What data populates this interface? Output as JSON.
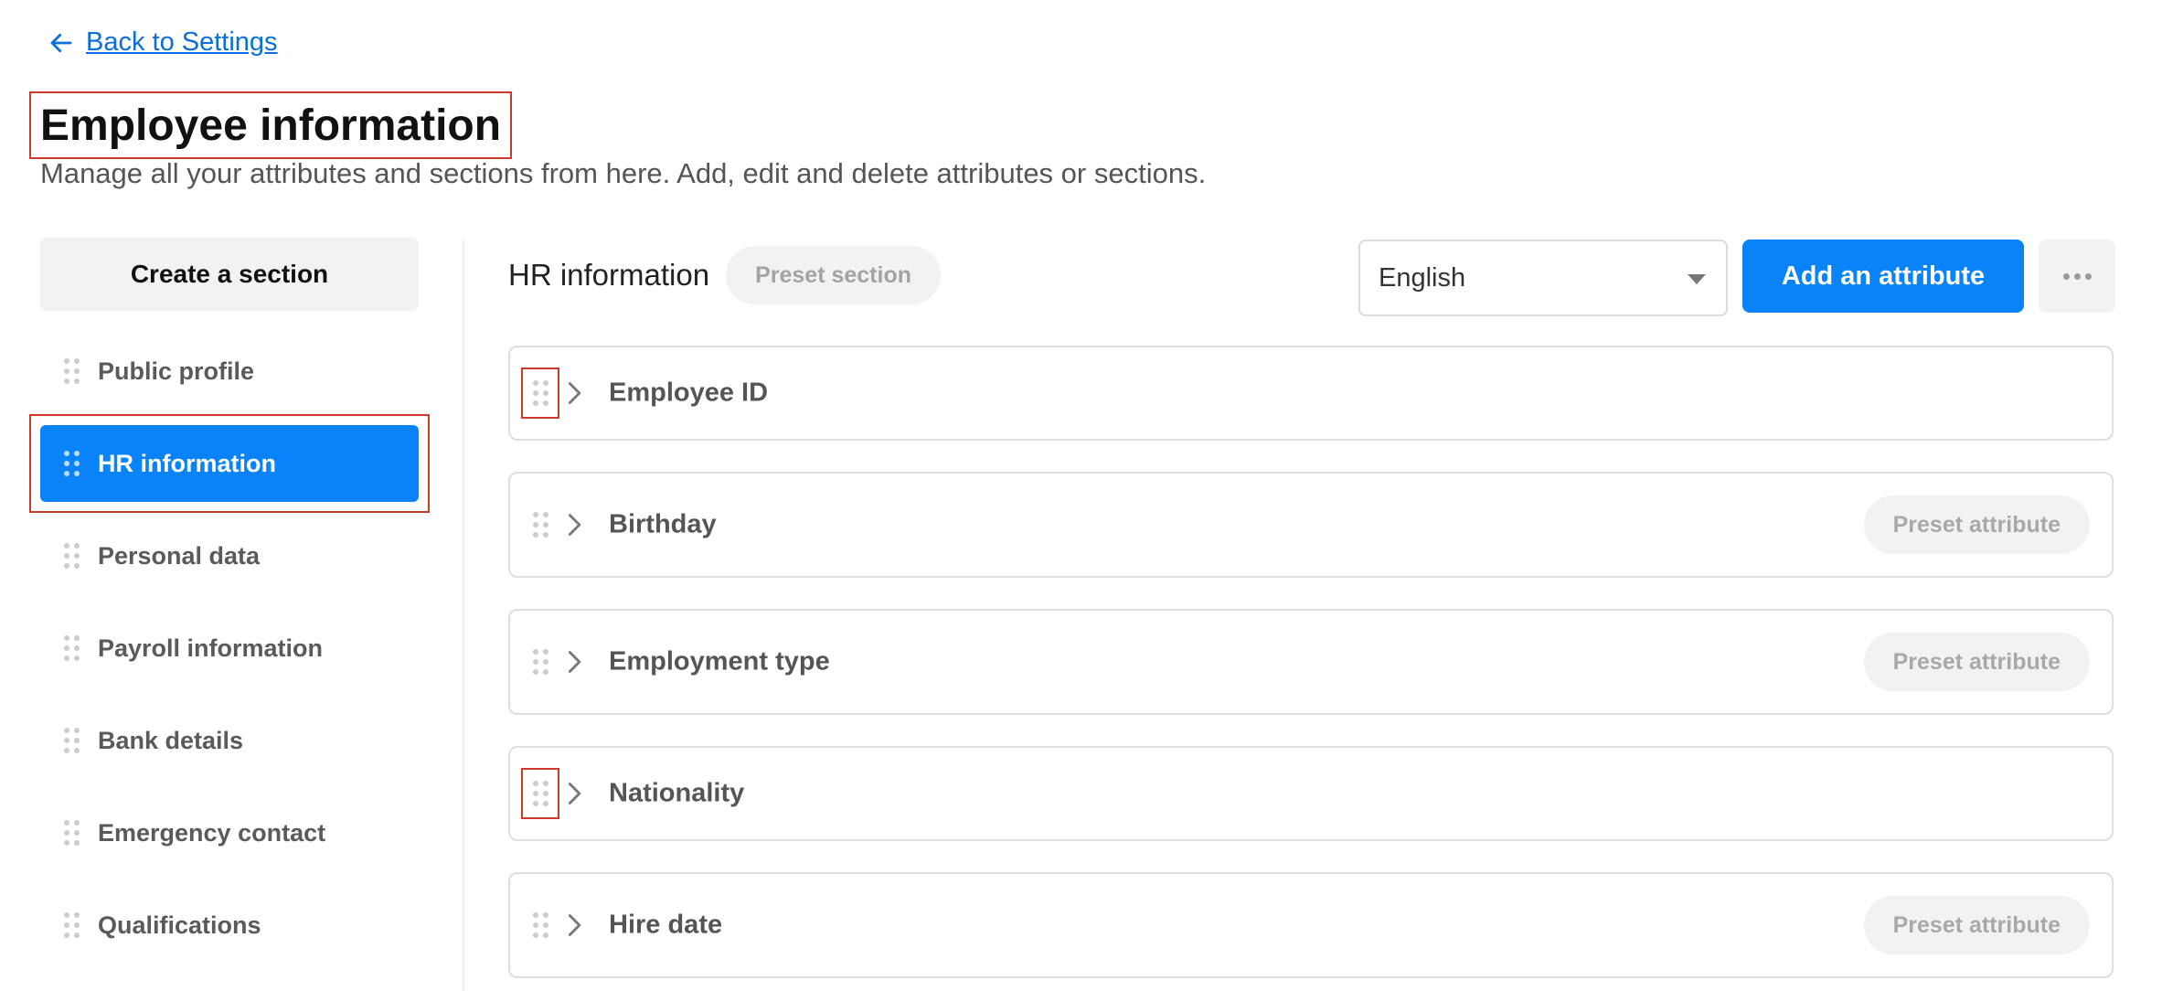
{
  "back_link": {
    "label": "Back to Settings"
  },
  "header": {
    "title": "Employee information",
    "subtitle": "Manage all your attributes and sections from here. Add, edit and delete attributes or sections."
  },
  "sidebar": {
    "create_label": "Create a section",
    "items": [
      {
        "label": "Public profile",
        "active": false
      },
      {
        "label": "HR information",
        "active": true
      },
      {
        "label": "Personal data",
        "active": false
      },
      {
        "label": "Payroll information",
        "active": false
      },
      {
        "label": "Bank details",
        "active": false
      },
      {
        "label": "Emergency contact",
        "active": false
      },
      {
        "label": "Qualifications",
        "active": false
      }
    ]
  },
  "main": {
    "section_title": "HR information",
    "section_badge": "Preset section",
    "language": {
      "selected": "English"
    },
    "add_label": "Add an attribute",
    "attributes": [
      {
        "name": "Employee ID",
        "badge": ""
      },
      {
        "name": "Birthday",
        "badge": "Preset attribute"
      },
      {
        "name": "Employment type",
        "badge": "Preset attribute"
      },
      {
        "name": "Nationality",
        "badge": ""
      },
      {
        "name": "Hire date",
        "badge": "Preset attribute"
      }
    ]
  },
  "colors": {
    "accent": "#0b83f8",
    "link": "#0a6fdb",
    "highlight_outline": "#cc3b2a",
    "pill_bg": "#f2f2f3"
  }
}
